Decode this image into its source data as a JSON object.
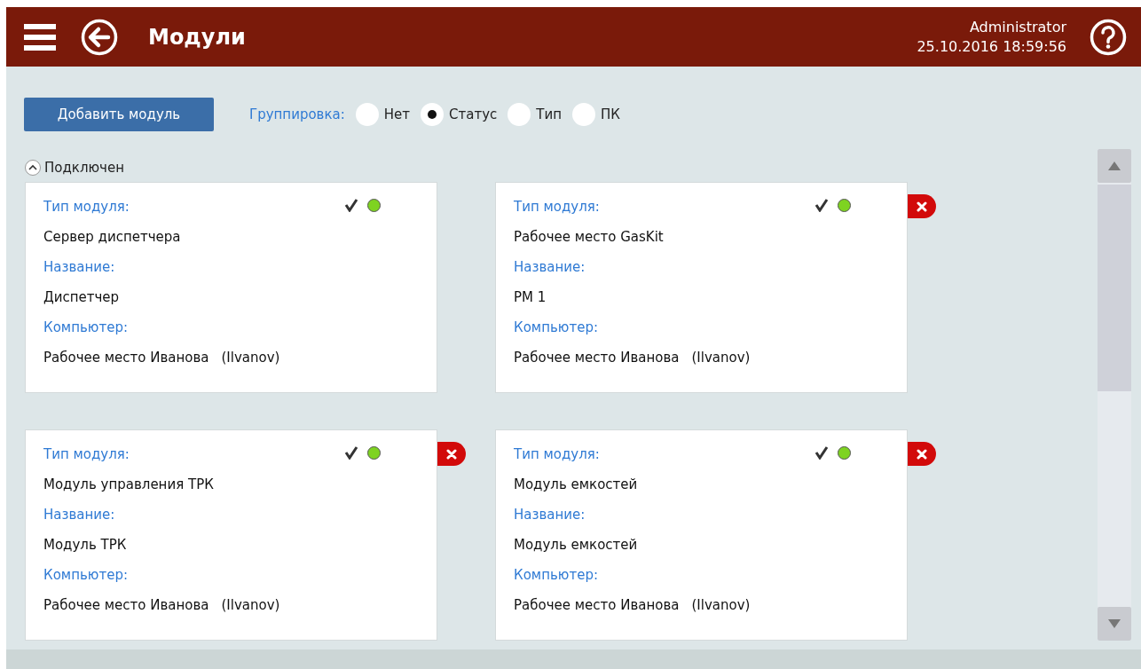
{
  "header": {
    "title": "Модули",
    "user": "Administrator",
    "datetime": "25.10.2016 18:59:56"
  },
  "toolbar": {
    "add_button": "Добавить модуль",
    "grouping_label": "Группировка:",
    "grouping_options": [
      {
        "label": "Нет",
        "selected": false
      },
      {
        "label": "Статус",
        "selected": true
      },
      {
        "label": "Тип",
        "selected": false
      },
      {
        "label": "ПК",
        "selected": false
      }
    ]
  },
  "group": {
    "title": "Подключен",
    "expanded": true,
    "modules": [
      {
        "type_label": "Тип модуля:",
        "type": "Сервер диспетчера",
        "name_label": "Название:",
        "name": "Диспетчер",
        "computer_label": "Компьютер:",
        "computer": "Рабочее место Иванова",
        "login": "(Ilvanov)",
        "checked": true,
        "online": true,
        "removable": false
      },
      {
        "type_label": "Тип модуля:",
        "type": "Рабочее место GasKit",
        "name_label": "Название:",
        "name": "РМ 1",
        "computer_label": "Компьютер:",
        "computer": "Рабочее место Иванова",
        "login": "(Ilvanov)",
        "checked": true,
        "online": true,
        "removable": true
      },
      {
        "type_label": "Тип модуля:",
        "type": "Модуль управления ТРК",
        "name_label": "Название:",
        "name": "Модуль ТРК",
        "computer_label": "Компьютер:",
        "computer": "Рабочее место Иванова",
        "login": "(Ilvanov)",
        "checked": true,
        "online": true,
        "removable": true
      },
      {
        "type_label": "Тип модуля:",
        "type": "Модуль емкостей",
        "name_label": "Название:",
        "name": "Модуль емкостей",
        "computer_label": "Компьютер:",
        "computer": "Рабочее место Иванова",
        "login": "(Ilvanov)",
        "checked": true,
        "online": true,
        "removable": true
      }
    ]
  }
}
